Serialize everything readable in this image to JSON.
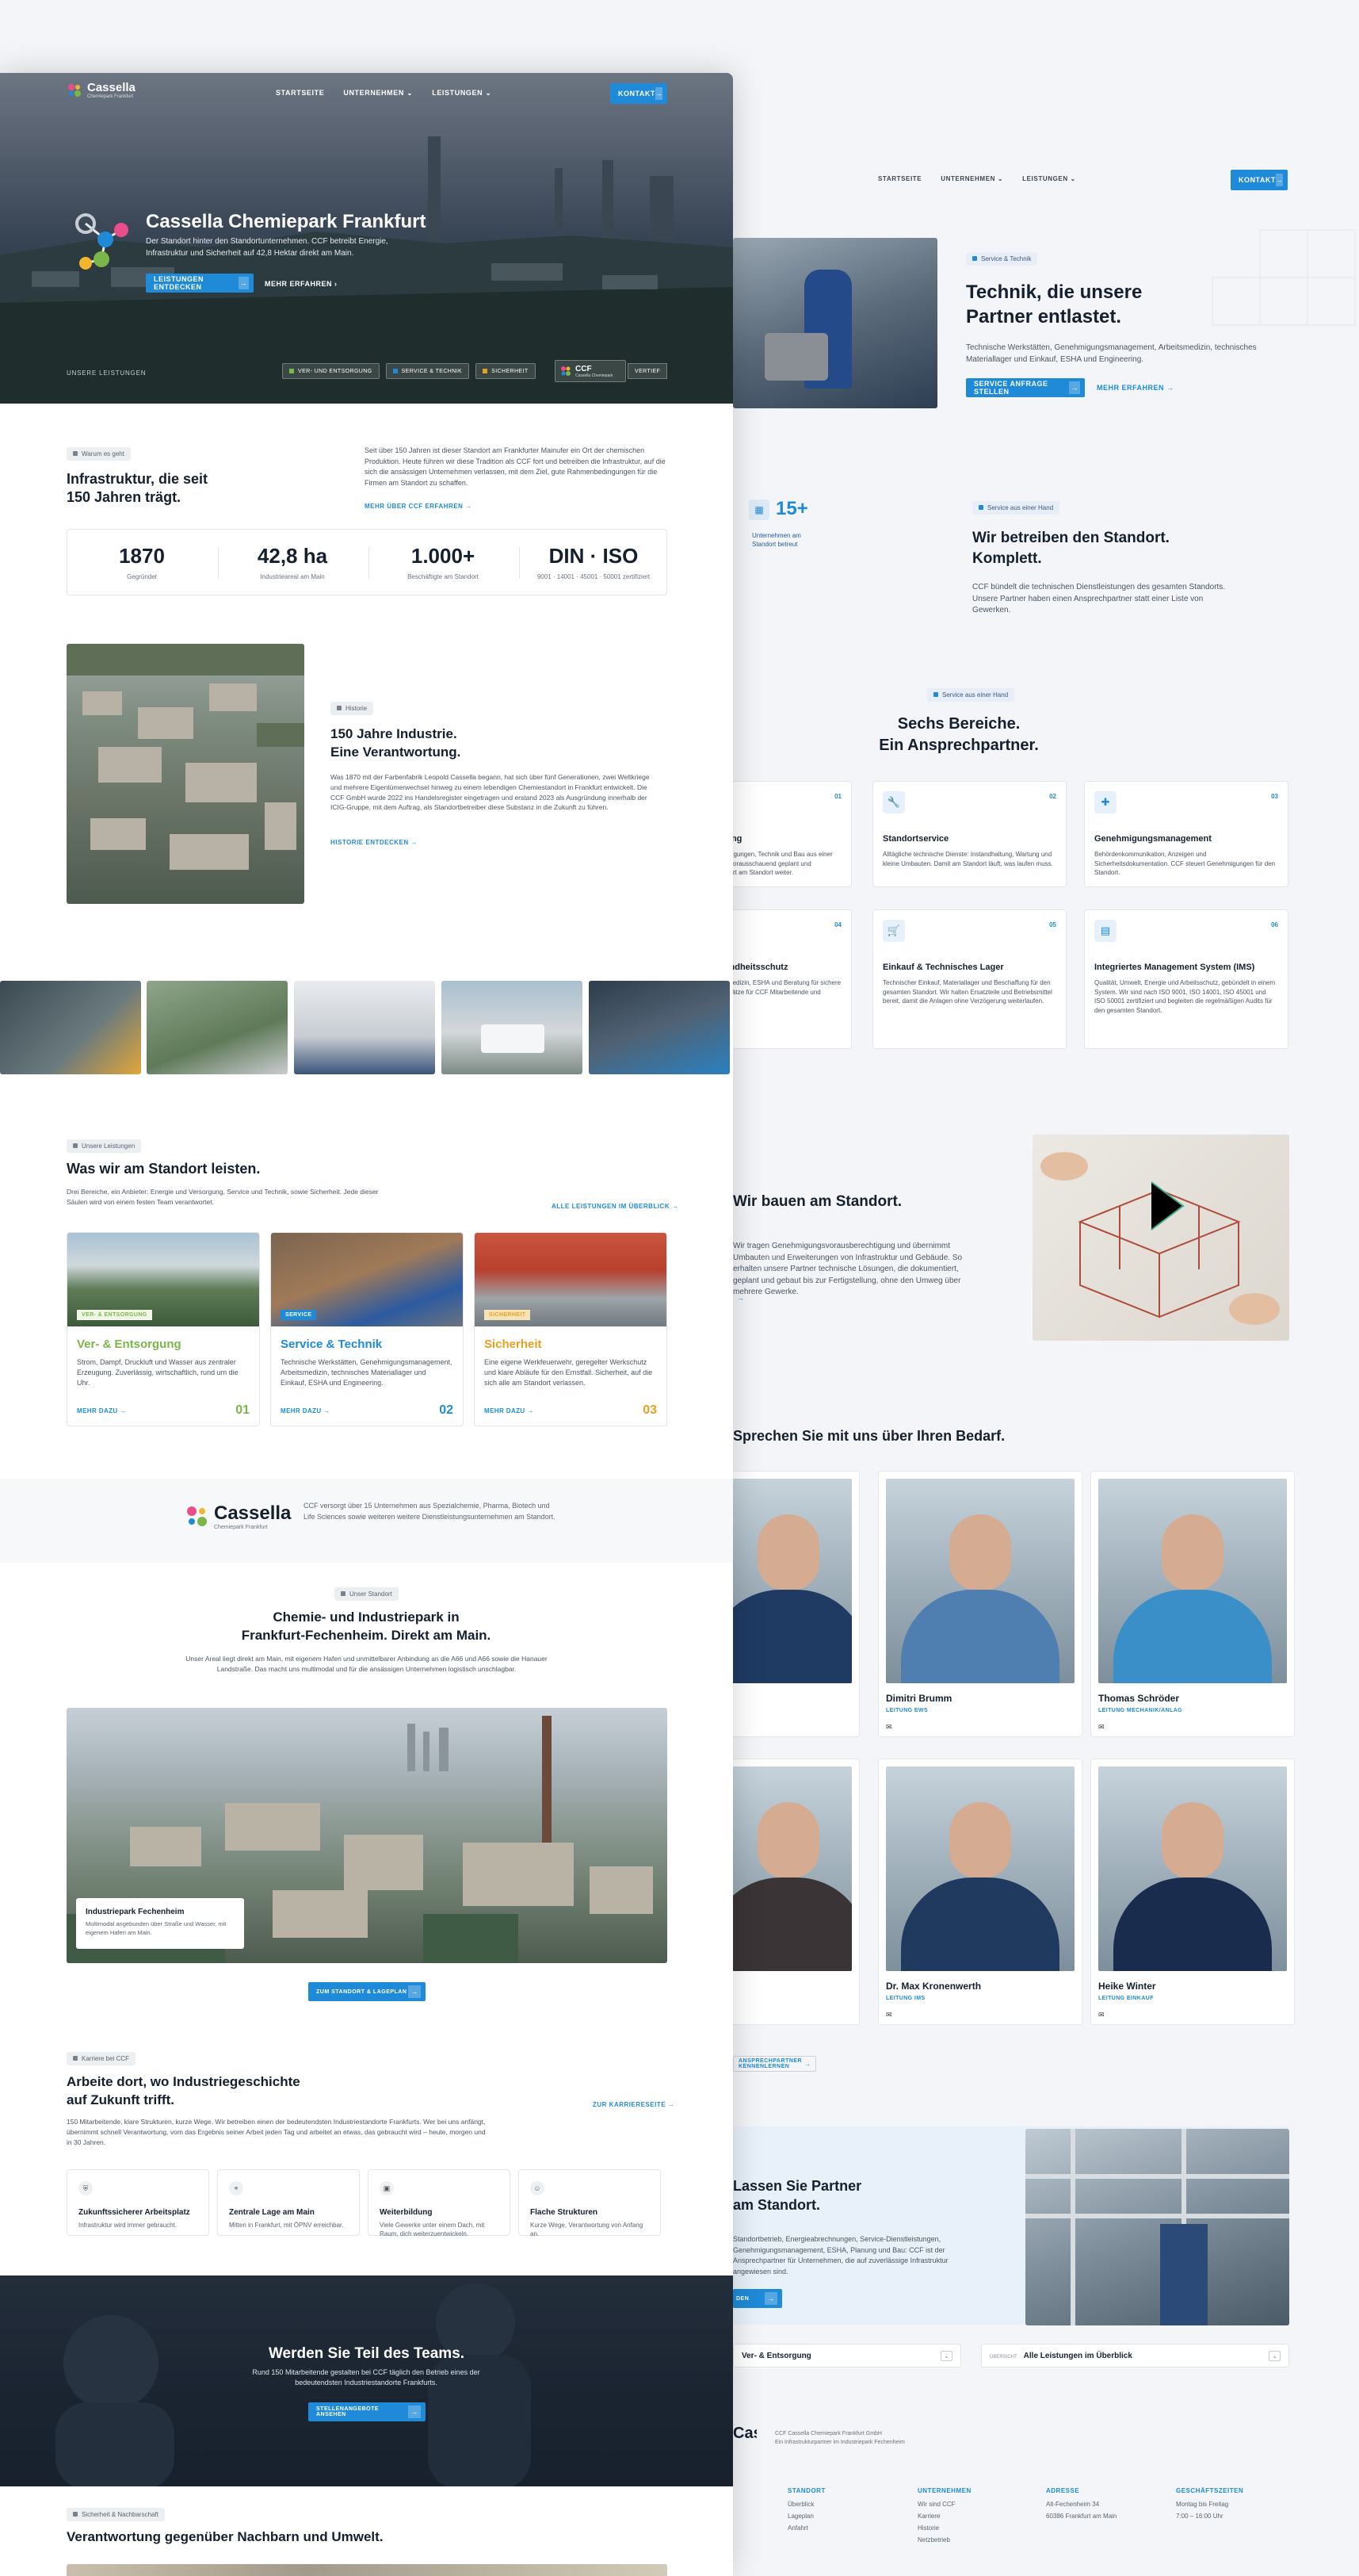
{
  "colors": {
    "accent": "#1e8ad8",
    "green": "#7ab648",
    "orange": "#e8a020",
    "navy": "#15202e"
  },
  "back": {
    "nav": {
      "items": [
        "STARTSEITE",
        "UNTERNEHMEN",
        "LEISTUNGEN"
      ],
      "cta": "KONTAKT"
    },
    "technik": {
      "pill": "Service & Technik",
      "title_line1": "Technik, die unsere",
      "title_line2": "Partner entlastet.",
      "text": "Technische Werkstätten, Genehmigungsmanagement, Arbeitsmedizin, technisches Materiallager und Einkauf, ESHA und Engineering.",
      "cta": "SERVICE ANFRAGE STELLEN",
      "link": "MEHR ERFAHREN"
    },
    "betreiben": {
      "badge_value": "15+",
      "badge_label": "Unternehmen am Standort betreut",
      "pill": "Service aus einer Hand",
      "title_line1": "Wir betreiben den Standort.",
      "title_line2": "Komplett.",
      "text": "CCF bündelt die technischen Dienstleistungen des gesamten Standorts. Unsere Partner haben einen Ansprechpartner statt einer Liste von Gewerken."
    },
    "bereiche": {
      "pill": "Service aus einer Hand",
      "title_line1": "Sechs Bereiche.",
      "title_line2": "Ein Ansprechpartner.",
      "cards": [
        {
          "num": "01",
          "title": "Planung",
          "text": "Genehmigungen, Technik und Bau aus einer Hand – vorausschauend geplant und umgesetzt am Standort weiter."
        },
        {
          "num": "02",
          "title": "Standortservice",
          "text": "Alltägliche technische Dienste: Instandhaltung, Wartung und kleine Umbauten. Damit am Standort läuft, was laufen muss."
        },
        {
          "num": "03",
          "title": "Genehmigungsmanagement",
          "text": "Behördenkommunikation, Anzeigen und Sicherheitsdokumentation. CCF steuert Genehmigungen für den Standort."
        },
        {
          "num": "04",
          "title": "Gesundheitsschutz",
          "text": "Arbeitsmedizin, ESHA und Beratung für sichere Arbeitsplätze für CCF Mitarbeitende und Partner."
        },
        {
          "num": "05",
          "title": "Einkauf & Technisches Lager",
          "text": "Technischer Einkauf, Materiallager und Beschaffung für den gesamten Standort. Wir halten Ersatzteile und Betriebsmittel bereit, damit die Anlagen ohne Verzögerung weiterlaufen."
        },
        {
          "num": "06",
          "title": "Integriertes Management System (IMS)",
          "text": "Qualität, Umwelt, Energie und Arbeitsschutz, gebündelt in einem System. Wir sind nach ISO 9001, ISO 14001, ISO 45001 und ISO 50001 zertifiziert und begleiten die regelmäßigen Audits für den gesamten Standort."
        }
      ]
    },
    "bauen": {
      "title": "Wir bauen am Standort.",
      "text": "Wir tragen Genehmigungsvorausberechtigung und übernimmt Umbauten und Erweiterungen von Infrastruktur und Gebäude. So erhalten unsere Partner technische Lösungen, die dokumentiert, geplant und gebaut bis zur Fertigstellung, ohne den Umweg über mehrere Gewerke."
    },
    "team": {
      "title": "Sprechen Sie mit uns über Ihren Bedarf.",
      "people": [
        {
          "name": "",
          "role": "",
          "mail": "✉"
        },
        {
          "name": "Dimitri Brumm",
          "role": "LEITUNG EWS",
          "mail": "✉"
        },
        {
          "name": "Thomas Schröder",
          "role": "LEITUNG MECHANIK/ANLAG",
          "mail": "✉"
        },
        {
          "name": "",
          "role": "",
          "mail": "✉"
        },
        {
          "name": "Dr. Max Kronenwerth",
          "role": "LEITUNG IMS",
          "mail": "✉"
        },
        {
          "name": "Heike Winter",
          "role": "LEITUNG EINKAUF",
          "mail": "✉"
        }
      ],
      "link": "ANSPRECHPARTNER KENNENLERNEN"
    },
    "partner": {
      "title_line1": "Lassen Sie Partner",
      "title_line2": "am Standort.",
      "text": "Standortbetrieb, Energieabrechnungen, Service-Dienstleistungen, Genehmigungsmanagement, ESHA, Planung und Bau: CCF ist der Ansprechpartner für Unternehmen, die auf zuverlässige Infrastruktur angewiesen sind.",
      "cta": "KONTAKT AUFNEHMEN"
    },
    "select1": {
      "value": "Ver- & Entsorgung"
    },
    "select2": {
      "label": "ÜBERSICHT",
      "value": "Alle Leistungen im Überblick"
    },
    "footer": {
      "brand": "Cassella",
      "line1": "CCF Cassella Chemiepark Frankfurt GmbH",
      "line2": "Ein Infrastrukturpartner im Industriepark Fechenheim",
      "cols": [
        {
          "h": "STANDORT",
          "items": [
            "Überblick",
            "Lageplan",
            "Anfahrt"
          ]
        },
        {
          "h": "UNTERNEHMEN",
          "items": [
            "Wir sind CCF",
            "Karriere",
            "Historie",
            "Netzbetrieb"
          ]
        },
        {
          "h": "ADRESSE",
          "items": [
            "Alt-Fechenheim 34",
            "60386 Frankfurt am Main"
          ]
        },
        {
          "h": "GESCHÄFTSZEITEN",
          "items": [
            "Montag bis Freitag",
            "7:00 – 16:00 Uhr"
          ]
        }
      ]
    }
  },
  "front": {
    "logo": {
      "name": "Cassella",
      "sub": "Chemiepark Frankfurt"
    },
    "nav": {
      "items": [
        "STARTSEITE",
        "UNTERNEHMEN",
        "LEISTUNGEN"
      ],
      "cta": "KONTAKT"
    },
    "hero": {
      "title": "Cassella Chemiepark Frankfurt",
      "text": "Der Standort hinter den Standortunternehmen. CCF betreibt Energie, Infrastruktur und Sicherheit auf 42,8 Hektar direkt am Main.",
      "cta": "LEISTUNGEN ENTDECKEN",
      "link": "MEHR ERFAHREN",
      "bar_label": "UNSERE LEISTUNGEN",
      "chips": [
        "VER- UND ENTSORGUNG",
        "SERVICE & TECHNIK",
        "SICHERHEIT"
      ],
      "ccf_name": "CCF",
      "ccf_sub": "Cassella Chemiepark",
      "ccf_chip": "VERTIEF"
    },
    "intro": {
      "pill": "Warum es geht",
      "title_line1": "Infrastruktur, die seit",
      "title_line2": "150 Jahren trägt.",
      "text": "Seit über 150 Jahren ist dieser Standort am Frankfurter Mainufer ein Ort der chemischen Produktion. Heute führen wir diese Tradition als CCF fort und betreiben die Infrastruktur, auf die sich die ansässigen Unternehmen verlassen, mit dem Ziel, gute Rahmenbedingungen für die Firmen am Standort zu schaffen.",
      "link": "MEHR ÜBER CCF ERFAHREN",
      "stats": [
        {
          "v": "1870",
          "l": "Gegründet"
        },
        {
          "v": "42,8 ha",
          "l": "Industrieareal am Main"
        },
        {
          "v": "1.000+",
          "l": "Beschäftigte am Standort"
        },
        {
          "v": "DIN · ISO",
          "l": "9001 · 14001 · 45001 · 50001 zertifiziert"
        }
      ]
    },
    "history": {
      "pill": "Historie",
      "title_line1": "150 Jahre Industrie.",
      "title_line2": "Eine Verantwortung.",
      "text": "Was 1870 mit der Farbenfabrik Leopold Cassella begann, hat sich über fünf Generationen, zwei Weltkriege und mehrere Eigentümerwechsel hinweg zu einem lebendigen Chemiestandort in Frankfurt entwickelt. Die CCF GmbH wurde 2022 ins Handelsregister eingetragen und erstand 2023 als Ausgründung innerhalb der ICIG-Gruppe, mit dem Auftrag, als Standortbetreiber diese Substanz in die Zukunft zu führen.",
      "link": "HISTORIE ENTDECKEN"
    },
    "services": {
      "pill": "Unsere Leistungen",
      "title": "Was wir am Standort leisten.",
      "text": "Drei Bereiche, ein Anbieter: Energie und Versorgung, Service und Technik, sowie Sicherheit. Jede dieser Säulen wird von einem festen Team verantwortet.",
      "link": "ALLE LEISTUNGEN IM ÜBERBLICK",
      "cards": [
        {
          "tag": "VER- & ENTSORGUNG",
          "title": "Ver- & Entsorgung",
          "text": "Strom, Dampf, Druckluft und Wasser aus zentraler Erzeugung. Zuverlässig, wirtschaftlich, rund um die Uhr.",
          "more": "MEHR DAZU",
          "num": "01",
          "color": "#7ab648"
        },
        {
          "tag": "SERVICE",
          "title": "Service & Technik",
          "text": "Technische Werkstätten, Genehmigungsmanagement, Arbeitsmedizin, technisches Materiallager und Einkauf, ESHA und Engineering.",
          "more": "MEHR DAZU",
          "num": "02",
          "color": "#1e8ad8"
        },
        {
          "tag": "SICHERHEIT",
          "title": "Sicherheit",
          "text": "Eine eigene Werkfeuerwehr, geregelter Werkschutz und klare Abläufe für den Ernstfall. Sicherheit, auf die sich alle am Standort verlassen.",
          "more": "MEHR DAZU",
          "num": "03",
          "color": "#e8a020"
        }
      ]
    },
    "cassella_band": {
      "brand": "Cassella",
      "sub": "Chemiepark Frankfurt",
      "text": "CCF versorgt über 15 Unternehmen aus Spezialchemie, Pharma, Biotech und Life Sciences sowie weiteren weitere Dienstleistungsunternehmen am Standort."
    },
    "standort": {
      "pill": "Unser Standort",
      "title_line1": "Chemie- und Industriepark in",
      "title_line2": "Frankfurt-Fechenheim. Direkt am Main.",
      "text": "Unser Areal liegt direkt am Main, mit eigenem Hafen und unmittelbarer Anbindung an die A66 und A66 sowie die Hanauer Landstraße. Das macht uns multimodal und für die ansässigen Unternehmen logistisch unschlagbar.",
      "card_title": "Industriepark Fechenheim",
      "card_text": "Multimodal angebunden über Straße und Wasser, mit eigenem Hafen am Main.",
      "cta": "ZUM STANDORT & LAGEPLAN"
    },
    "karriere": {
      "pill": "Karriere bei CCF",
      "title_line1": "Arbeite dort, wo Industriegeschichte",
      "title_line2": "auf Zukunft trifft.",
      "text": "150 Mitarbeitende, klare Strukturen, kurze Wege. Wir betreiben einen der bedeutendsten Industriestandorte Frankfurts. Wer bei uns anfängt, übernimmt schnell Verantwortung, vom das Ergebnis seiner Arbeit jeden Tag und arbeitet an etwas, das gebraucht wird – heute, morgen und in 30 Jahren.",
      "link": "ZUR KARRIERESEITE",
      "features": [
        {
          "icon": "shield-icon",
          "title": "Zukunftssicherer Arbeitsplatz",
          "text": "Infrastruktur wird immer gebraucht."
        },
        {
          "icon": "pin-icon",
          "title": "Zentrale Lage am Main",
          "text": "Mitten in Frankfurt, mit ÖPNV erreichbar."
        },
        {
          "icon": "book-icon",
          "title": "Weiterbildung",
          "text": "Viele Gewerke unter einem Dach, mit Raum, dich weiterzuentwickeln."
        },
        {
          "icon": "people-icon",
          "title": "Flache Strukturen",
          "text": "Kurze Wege, Verantwortung von Anfang an."
        }
      ]
    },
    "team_band": {
      "title": "Werden Sie Teil des Teams.",
      "text": "Rund 150 Mitarbeitende gestalten bei CCF täglich den Betrieb eines der bedeutendsten Industriestandorte Frankfurts.",
      "cta": "STELLENANGEBOTE ANSEHEN"
    },
    "umwelt": {
      "pill": "Sicherheit & Nachbarschaft",
      "title": "Verantwortung gegenüber Nachbarn und Umwelt."
    }
  }
}
